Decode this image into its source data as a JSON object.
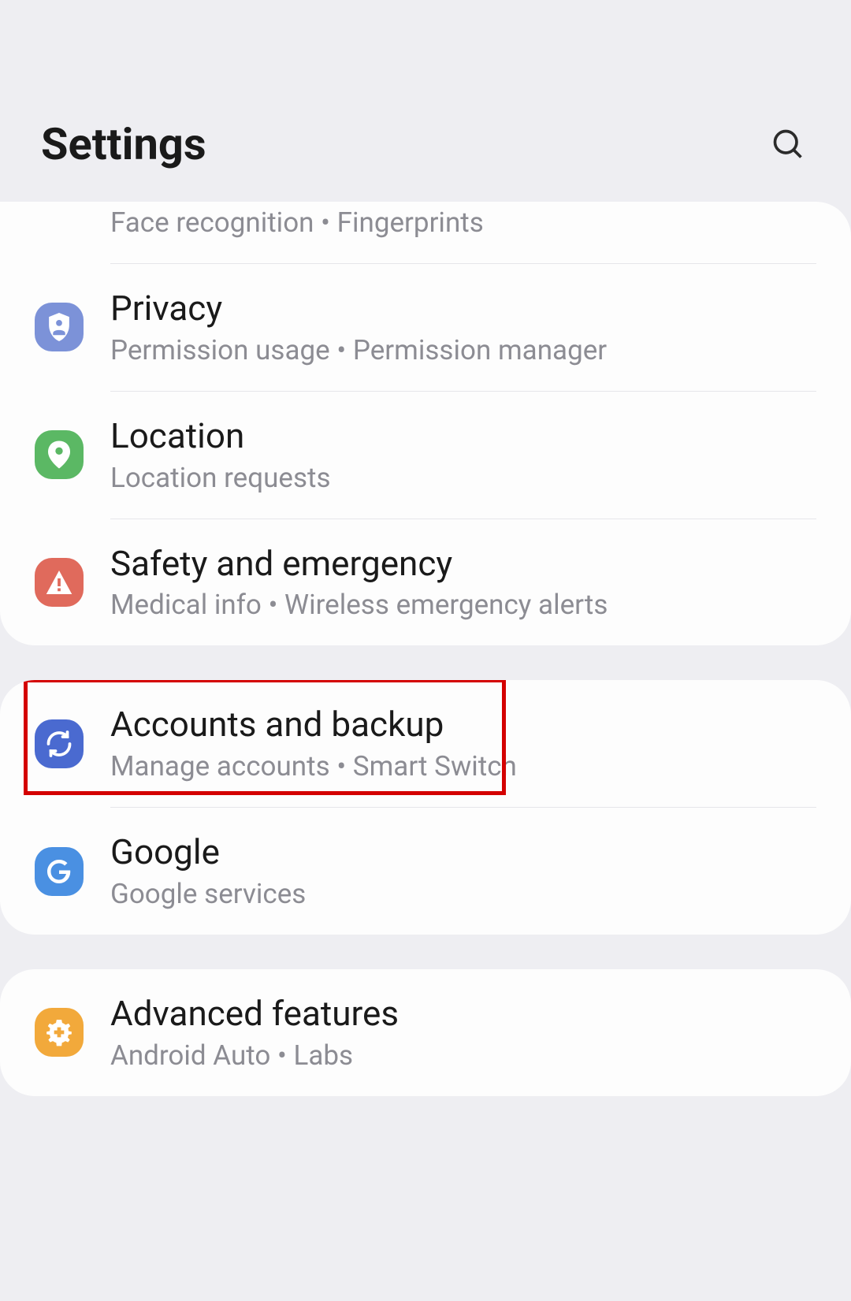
{
  "header": {
    "title": "Settings"
  },
  "groups": [
    {
      "items": [
        {
          "id": "biometrics",
          "title": "",
          "sub": "Face recognition  •  Fingerprints",
          "partial": true,
          "icon": "fingerprint-icon",
          "iconClass": "ic-biometrics"
        },
        {
          "id": "privacy",
          "title": "Privacy",
          "sub": "Permission usage  •  Permission manager",
          "icon": "shield-person-icon",
          "iconClass": "ic-privacy"
        },
        {
          "id": "location",
          "title": "Location",
          "sub": "Location requests",
          "icon": "location-pin-icon",
          "iconClass": "ic-location"
        },
        {
          "id": "safety",
          "title": "Safety and emergency",
          "sub": "Medical info  •  Wireless emergency alerts",
          "icon": "warning-icon",
          "iconClass": "ic-safety"
        }
      ]
    },
    {
      "items": [
        {
          "id": "accounts",
          "title": "Accounts and backup",
          "sub": "Manage accounts  •  Smart Switch",
          "icon": "sync-icon",
          "iconClass": "ic-accounts",
          "highlight": true
        },
        {
          "id": "google",
          "title": "Google",
          "sub": "Google services",
          "icon": "google-g-icon",
          "iconClass": "ic-google"
        }
      ]
    },
    {
      "items": [
        {
          "id": "advanced",
          "title": "Advanced features",
          "sub": "Android Auto  •  Labs",
          "icon": "gear-plus-icon",
          "iconClass": "ic-advanced"
        }
      ]
    }
  ]
}
